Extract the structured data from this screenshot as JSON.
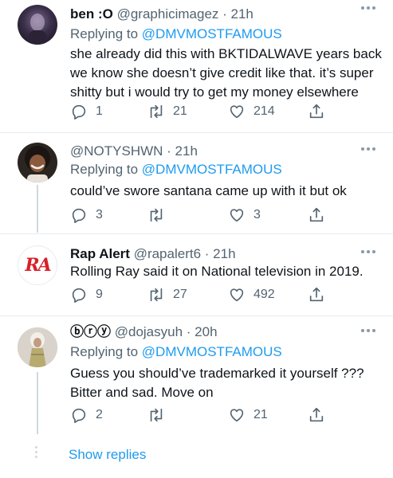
{
  "tweets": [
    {
      "name": "ben :O",
      "handle": "@graphicimagez",
      "time": "· 21h",
      "replying_prefix": "Replying to",
      "replying_to": "@DMVMOSTFAMOUS",
      "body": "she already did this with BKTIDALWAVE years back we know she doesn’t give credit like that. it’s super shitty but i would try to get my money elsewhere",
      "replies": "1",
      "retweets": "21",
      "likes": "214"
    },
    {
      "name": "",
      "handle": "@NOTYSHWN",
      "time": "· 21h",
      "replying_prefix": "Replying to",
      "replying_to": "@DMVMOSTFAMOUS",
      "body": "could’ve swore santana came up with it but ok",
      "replies": "3",
      "retweets": "",
      "likes": "3"
    },
    {
      "name": "Rap Alert",
      "handle": "@rapalert6",
      "time": "· 21h",
      "avatar_text": "RA",
      "body": "Rolling Ray said it on National television in 2019.",
      "replies": "9",
      "retweets": "27",
      "likes": "492"
    },
    {
      "name": "ⓑⓡⓨ",
      "handle": "@dojasyuh",
      "time": "· 20h",
      "replying_prefix": "Replying to",
      "replying_to": "@DMVMOSTFAMOUS",
      "body": "Guess you should’ve trademarked it yourself ??? Bitter and sad. Move on",
      "replies": "2",
      "retweets": "",
      "likes": "21"
    }
  ],
  "show_replies": "Show replies",
  "icons": {
    "reply": "reply-icon",
    "retweet": "retweet-icon",
    "like": "heart-icon",
    "share": "share-icon",
    "more": "more-icon"
  },
  "colors": {
    "text": "#0f1419",
    "secondary": "#536471",
    "accent": "#1d9bf0",
    "divider": "#e6ecf0",
    "thread_line": "#cfd9de"
  }
}
